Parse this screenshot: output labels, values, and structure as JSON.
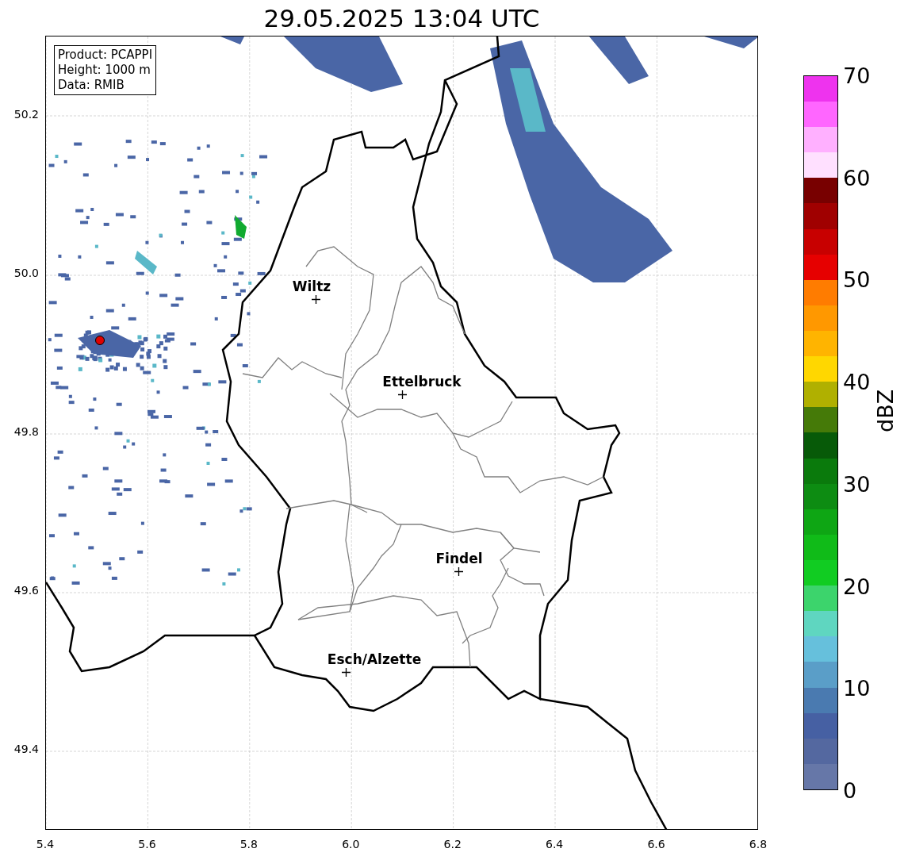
{
  "title": "29.05.2025 13:04 UTC",
  "info_box": [
    "Product: PCAPPI",
    "Height: 1000 m",
    "Data: RMIB"
  ],
  "x_ticks": [
    "5.4",
    "5.6",
    "5.8",
    "6.0",
    "6.2",
    "6.4",
    "6.6",
    "6.8"
  ],
  "y_ticks": [
    "50.2",
    "50.0",
    "49.8",
    "49.6",
    "49.4"
  ],
  "cities": [
    {
      "name": "Wiltz"
    },
    {
      "name": "Ettelbruck"
    },
    {
      "name": "Findel"
    },
    {
      "name": "Esch/Alzette"
    }
  ],
  "colorbar": {
    "label": "dBZ",
    "ticks": [
      "70",
      "60",
      "50",
      "40",
      "30",
      "20",
      "10",
      "0"
    ],
    "bins": [
      {
        "color": "#6677a8"
      },
      {
        "color": "#5468a0"
      },
      {
        "color": "#4660a3"
      },
      {
        "color": "#4a7ab0"
      },
      {
        "color": "#5a9ec8"
      },
      {
        "color": "#66c0dc"
      },
      {
        "color": "#5fd6c0"
      },
      {
        "color": "#3cd46c"
      },
      {
        "color": "#11cc22"
      },
      {
        "color": "#10bb18"
      },
      {
        "color": "#0ea614"
      },
      {
        "color": "#0d8c12"
      },
      {
        "color": "#0a7a0c"
      },
      {
        "color": "#075a08"
      },
      {
        "color": "#457a08"
      },
      {
        "color": "#b0b000"
      },
      {
        "color": "#ffd700"
      },
      {
        "color": "#ffb400"
      },
      {
        "color": "#ff9800"
      },
      {
        "color": "#ff7c00"
      },
      {
        "color": "#e60000"
      },
      {
        "color": "#c80000"
      },
      {
        "color": "#a00000"
      },
      {
        "color": "#780000"
      },
      {
        "color": "#ffe0ff"
      },
      {
        "color": "#ffb0ff"
      },
      {
        "color": "#ff66ff"
      },
      {
        "color": "#ee33ee"
      }
    ]
  }
}
